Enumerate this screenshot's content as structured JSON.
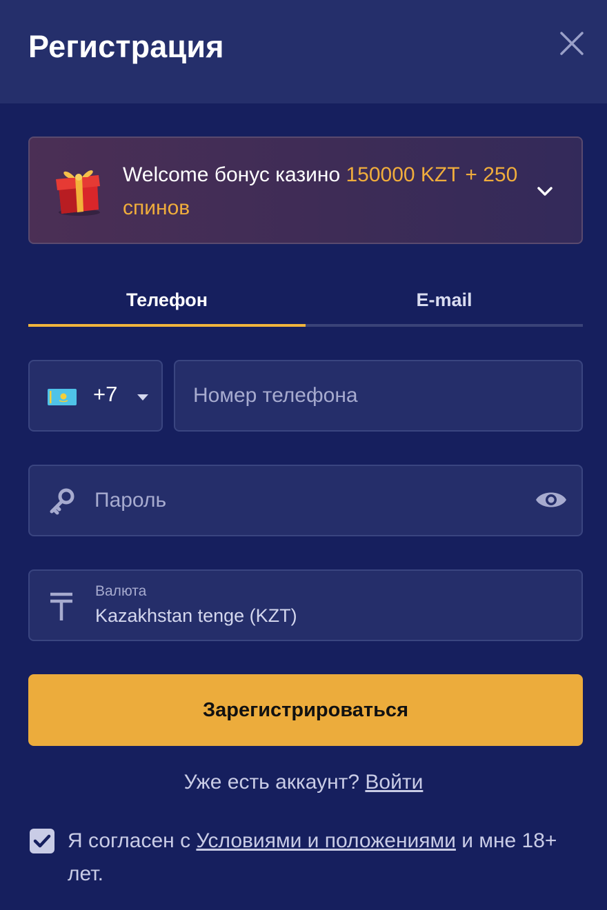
{
  "header": {
    "title": "Регистрация"
  },
  "bonus": {
    "text_main": "Welcome бонус казино ",
    "text_accent": "150000 KZT + 250 спинов"
  },
  "tabs": [
    {
      "label": "Телефон",
      "active": true
    },
    {
      "label": "E-mail",
      "active": false
    }
  ],
  "phone": {
    "country_code": "+7",
    "placeholder": "Номер телефона"
  },
  "password": {
    "placeholder": "Пароль"
  },
  "currency": {
    "label": "Валюта",
    "value": "Kazakhstan tenge (KZT)"
  },
  "actions": {
    "register_label": "Зарегистрироваться"
  },
  "login": {
    "prompt": "Уже есть аккаунт? ",
    "link_label": "Войти"
  },
  "agreement": {
    "text_before": "Я согласен с ",
    "link_label": "Условиями и положениями",
    "text_after": " и мне 18+ лет.",
    "checked": true
  },
  "colors": {
    "background": "#161f5e",
    "header": "#252f6b",
    "accent": "#f0ad3c",
    "button": "#ecac3c"
  }
}
